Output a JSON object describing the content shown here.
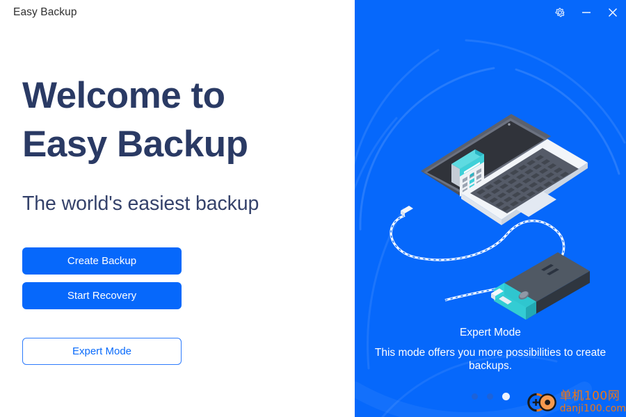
{
  "window": {
    "title": "Easy Backup",
    "controls": [
      {
        "name": "settings-button",
        "icon": "gear-icon"
      },
      {
        "name": "minimize-button",
        "icon": "minimize-icon"
      },
      {
        "name": "close-button",
        "icon": "close-icon"
      }
    ]
  },
  "hero": {
    "headline_line1": "Welcome to",
    "headline_line2": "Easy Backup",
    "subheadline": "The world's easiest backup"
  },
  "actions": {
    "create_backup": "Create Backup",
    "start_recovery": "Start Recovery",
    "expert_mode": "Expert Mode"
  },
  "panel": {
    "caption_title": "Expert Mode",
    "caption_body": "This mode offers you more possibilities to create backups.",
    "illustration": "isometric-laptop-with-calendar-and-external-hard-drive",
    "carousel": {
      "total": 3,
      "active_index": 3
    }
  },
  "watermark": {
    "name_cn": "单机100网",
    "url": "danji100.com"
  },
  "colors": {
    "brand_blue": "#0668fb",
    "headline_navy": "#2a3a64",
    "panel_blue": "#0668fb",
    "accent_teal": "#3fd0d8",
    "watermark_orange": "#f07513"
  }
}
